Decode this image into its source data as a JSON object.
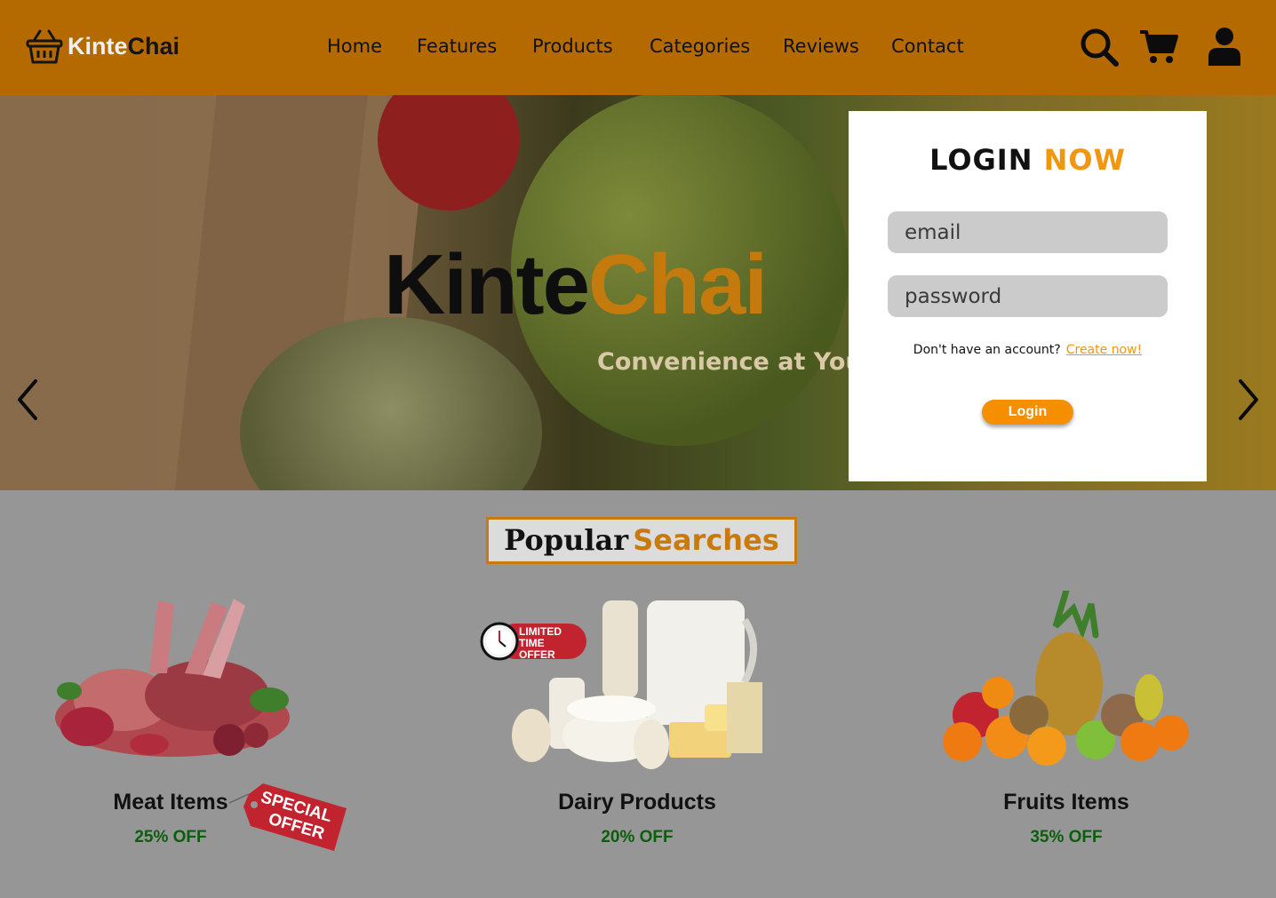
{
  "brand": {
    "name_part1": "Kinte",
    "name_part2": "Chai"
  },
  "nav": {
    "links": [
      {
        "label": "Home"
      },
      {
        "label": "Features"
      },
      {
        "label": "Products"
      },
      {
        "label": "Categories"
      },
      {
        "label": "Reviews"
      },
      {
        "label": "Contact"
      }
    ],
    "icons": [
      "search-icon",
      "cart-icon",
      "user-icon"
    ]
  },
  "hero": {
    "title_part1": "Kinte",
    "title_part2": "Chai",
    "tagline": "Convenience at You",
    "prev_icon": "chevron-left-icon",
    "next_icon": "chevron-right-icon"
  },
  "login": {
    "title_part1": "LOGIN",
    "title_part2": "NOW",
    "email_placeholder": "email",
    "password_placeholder": "password",
    "signup_prompt": "Don't have an account?",
    "signup_link": "Create now!",
    "button_label": "Login"
  },
  "popular": {
    "title_part1": "Popular",
    "title_part2": "Searches",
    "items": [
      {
        "name": "Meat Items",
        "discount": "25% OFF",
        "badge_line1": "SPECIAL",
        "badge_line2": "OFFER"
      },
      {
        "name": "Dairy Products",
        "discount": "20% OFF",
        "badge_line1": "LIMITED",
        "badge_line2": "TIME",
        "badge_line3": "OFFER"
      },
      {
        "name": "Fruits Items",
        "discount": "35% OFF"
      }
    ]
  },
  "colors": {
    "nav_bg": "#b56a00",
    "accent": "#f0960f",
    "accent_dark": "#c97a0c",
    "discount": "#0b5e0b",
    "page_bg": "#969696"
  }
}
